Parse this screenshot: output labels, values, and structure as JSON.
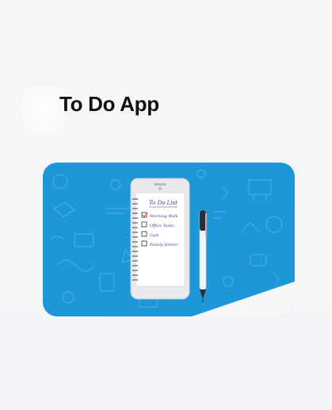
{
  "app": {
    "title": "To Do App"
  },
  "hero": {
    "illustration": "notebook-phone-and-pen",
    "colors": {
      "background": "#1e97d8",
      "doodle": "#5fb8e6",
      "phone": "#e9ebee",
      "paper": "#ffffff",
      "ink": "#3b3f8f"
    },
    "list_title": "To Do List",
    "items": [
      {
        "label": "Morning Walk",
        "checked": true
      },
      {
        "label": "Office Tasks",
        "checked": false
      },
      {
        "label": "Gym",
        "checked": false
      },
      {
        "label": "Family Dinner",
        "checked": false
      }
    ]
  }
}
